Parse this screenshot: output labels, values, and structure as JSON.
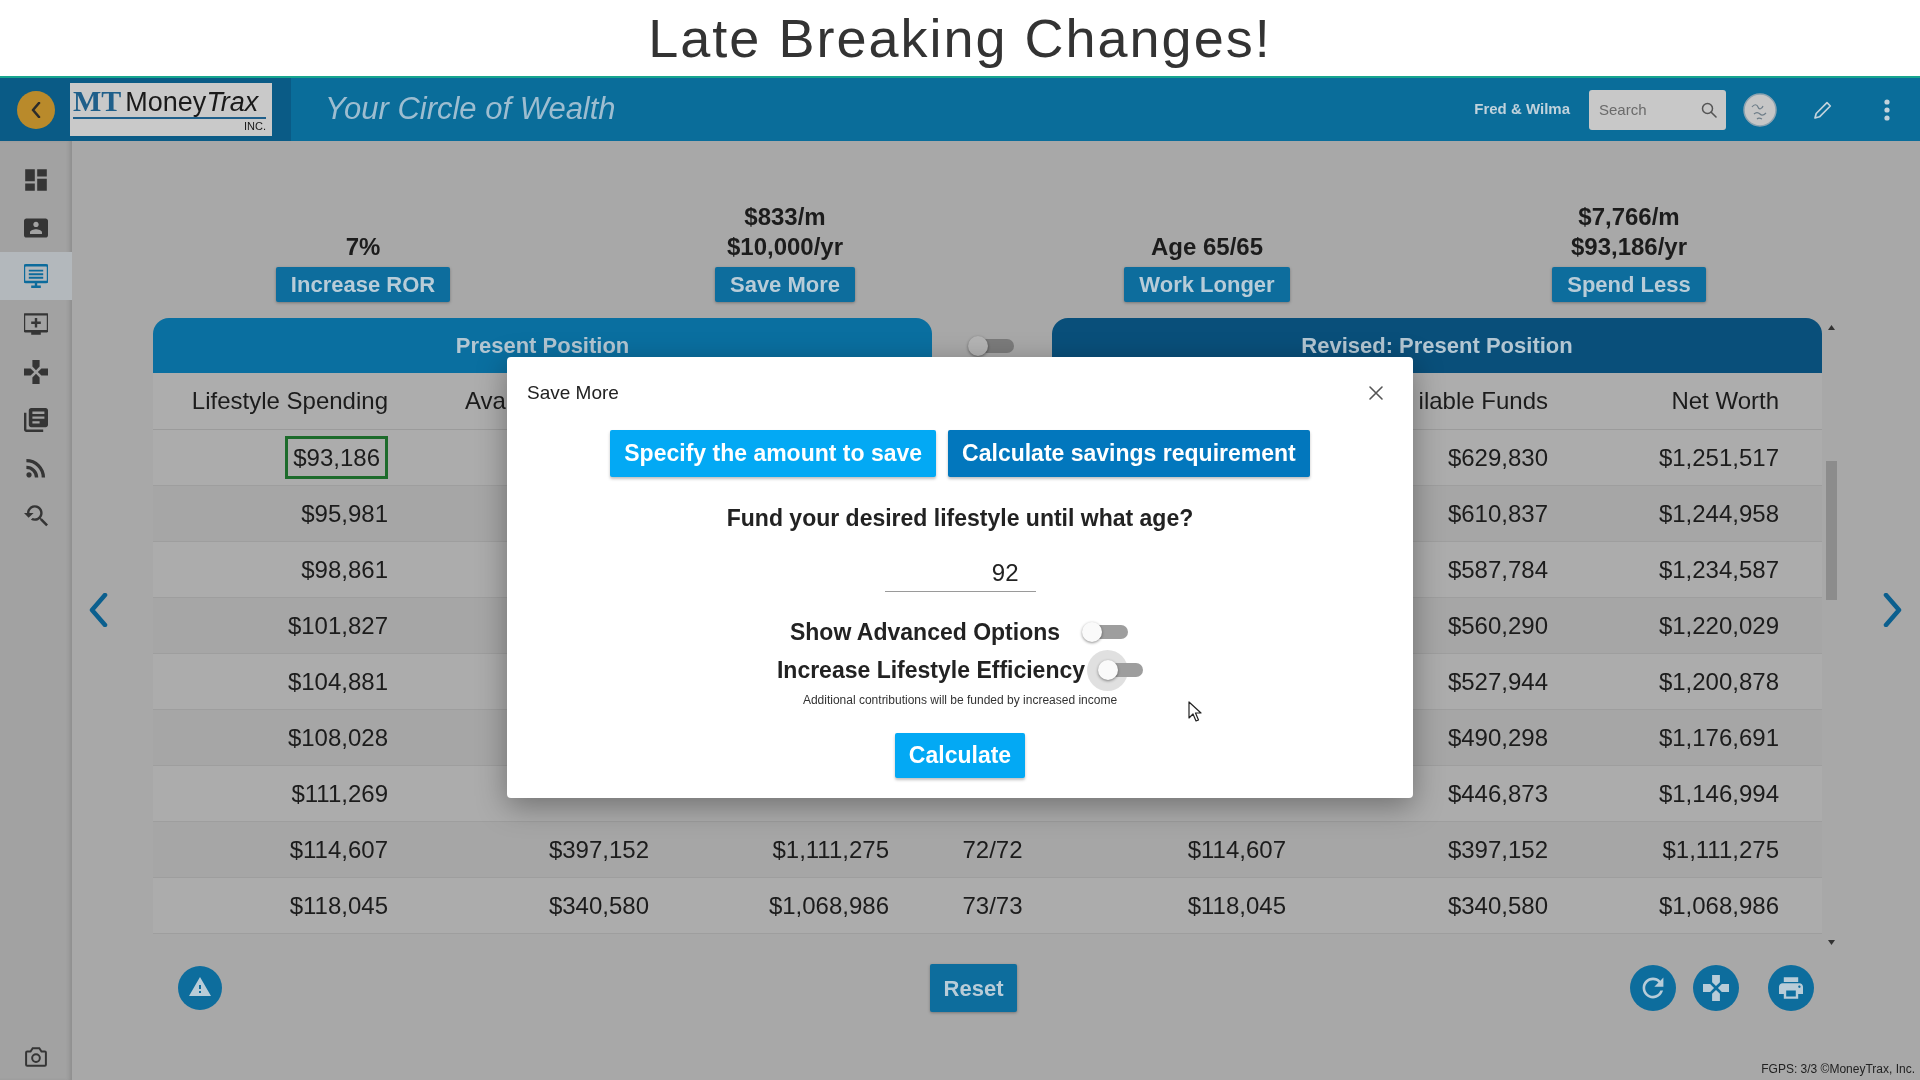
{
  "banner": {
    "title": "Late Breaking Changes!"
  },
  "header": {
    "logo": {
      "mark": "MT",
      "name": [
        {
          "text": "Money",
          "italic": false
        },
        {
          "text": "Trax",
          "italic": true
        }
      ],
      "suffix": "INC."
    },
    "tagline": "Your Circle of Wealth",
    "user": "Fred & Wilma",
    "search": {
      "placeholder": "Search"
    }
  },
  "sidebar": {
    "items": [
      {
        "selected": false
      },
      {
        "selected": false
      },
      {
        "selected": true
      },
      {
        "selected": false
      },
      {
        "selected": false
      },
      {
        "selected": false
      },
      {
        "selected": false
      },
      {
        "selected": false
      }
    ]
  },
  "scenarios": [
    {
      "values": [
        "7%"
      ],
      "button": "Increase ROR"
    },
    {
      "values": [
        "$833/m",
        "$10,000/yr"
      ],
      "button": "Save More"
    },
    {
      "values": [
        "Age 65/65"
      ],
      "button": "Work Longer"
    },
    {
      "values": [
        "$7,766/m",
        "$93,186/yr"
      ],
      "button": "Spend Less"
    }
  ],
  "table": {
    "panels": [
      {
        "title": "Present Position"
      },
      {
        "title": "Revised: Present Position"
      }
    ],
    "panel_toggle": {
      "on": false
    },
    "columns": [
      "Lifestyle Spending",
      "Ava",
      null,
      null,
      null,
      "ilable Funds",
      "Net Worth"
    ],
    "rows": [
      {
        "selected": true,
        "cells": [
          "$93,186",
          null,
          null,
          null,
          null,
          "$629,830",
          "$1,251,517"
        ]
      },
      {
        "selected": false,
        "cells": [
          "$95,981",
          null,
          null,
          null,
          null,
          "$610,837",
          "$1,244,958"
        ]
      },
      {
        "selected": false,
        "cells": [
          "$98,861",
          null,
          null,
          null,
          null,
          "$587,784",
          "$1,234,587"
        ]
      },
      {
        "selected": false,
        "cells": [
          "$101,827",
          null,
          null,
          null,
          null,
          "$560,290",
          "$1,220,029"
        ]
      },
      {
        "selected": false,
        "cells": [
          "$104,881",
          null,
          null,
          null,
          null,
          "$527,944",
          "$1,200,878"
        ]
      },
      {
        "selected": false,
        "cells": [
          "$108,028",
          null,
          null,
          null,
          null,
          "$490,298",
          "$1,176,691"
        ]
      },
      {
        "selected": false,
        "cells": [
          "$111,269",
          null,
          null,
          null,
          null,
          "$446,873",
          "$1,146,994"
        ]
      },
      {
        "selected": false,
        "cells": [
          "$114,607",
          "$397,152",
          "$1,111,275",
          "72/72",
          "$114,607",
          "$397,152",
          "$1,111,275"
        ]
      },
      {
        "selected": false,
        "cells": [
          "$118,045",
          "$340,580",
          "$1,068,986",
          "73/73",
          "$118,045",
          "$340,580",
          "$1,068,986"
        ]
      }
    ]
  },
  "actions": {
    "reset": "Reset"
  },
  "dialog": {
    "title": "Save More",
    "modes": [
      {
        "label": "Specify the amount to save",
        "selected": false
      },
      {
        "label": "Calculate savings requirement",
        "selected": true
      }
    ],
    "question": "Fund your desired lifestyle until what age?",
    "age": {
      "value": "92"
    },
    "options": [
      {
        "label": "Show Advanced Options",
        "on": false,
        "focused": false
      },
      {
        "label": "Increase Lifestyle Efficiency",
        "on": false,
        "focused": true
      }
    ],
    "note": "Additional contributions will be funded by increased income",
    "submit": "Calculate"
  },
  "footer": {
    "text": "FGPS: 3/3 ©MoneyTrax, Inc."
  }
}
